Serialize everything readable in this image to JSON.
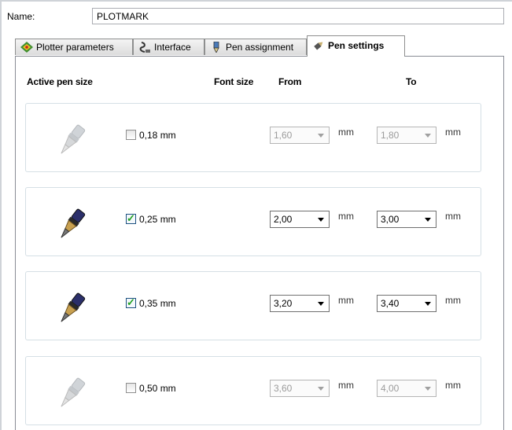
{
  "name_field": {
    "label": "Name:",
    "value": "PLOTMARK"
  },
  "tabs": [
    {
      "label": "Plotter parameters",
      "icon": "plotter-icon"
    },
    {
      "label": "Interface",
      "icon": "interface-icon"
    },
    {
      "label": "Pen assignment",
      "icon": "pen-assignment-icon"
    },
    {
      "label": "Pen settings",
      "icon": "pen-settings-icon",
      "active": true
    }
  ],
  "headers": {
    "active_pen_size": "Active pen size",
    "font_size": "Font size",
    "from": "From",
    "to": "To"
  },
  "pens": [
    {
      "size": "0,18 mm",
      "checked": false,
      "from": "1,60",
      "to": "1,80",
      "from_unit": "mm",
      "to_unit": "mm",
      "enabled": false
    },
    {
      "size": "0,25 mm",
      "checked": true,
      "from": "2,00",
      "to": "3,00",
      "from_unit": "mm",
      "to_unit": "mm",
      "enabled": true
    },
    {
      "size": "0,35 mm",
      "checked": true,
      "from": "3,20",
      "to": "3,40",
      "from_unit": "mm",
      "to_unit": "mm",
      "enabled": true
    },
    {
      "size": "0,50 mm",
      "checked": false,
      "from": "3,60",
      "to": "4,00",
      "from_unit": "mm",
      "to_unit": "mm",
      "enabled": false
    }
  ]
}
